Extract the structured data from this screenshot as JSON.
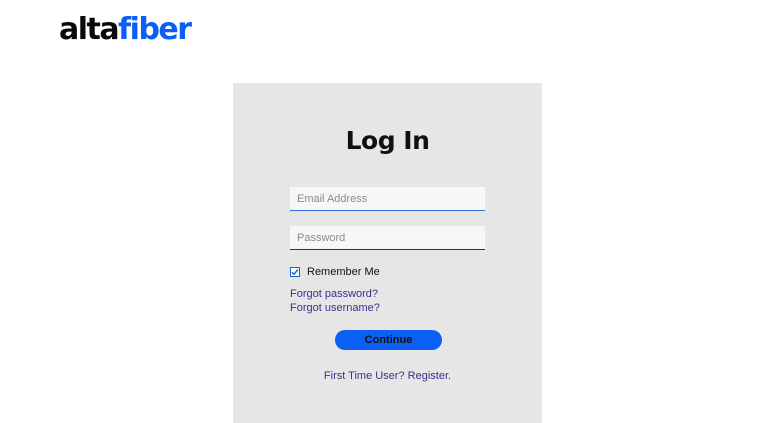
{
  "brand": {
    "logo_part1": "alta",
    "logo_part2": "fiber",
    "accent_color": "#0b5ff5"
  },
  "login": {
    "title": "Log In",
    "email_placeholder": "Email Address",
    "email_value": "",
    "password_placeholder": "Password",
    "password_value": "",
    "remember_label": "Remember Me",
    "remember_checked": true,
    "forgot_password": "Forgot password?",
    "forgot_username": "Forgot username?",
    "continue_label": "Continue",
    "first_time_text": "First Time User?",
    "register_text": "Register."
  }
}
